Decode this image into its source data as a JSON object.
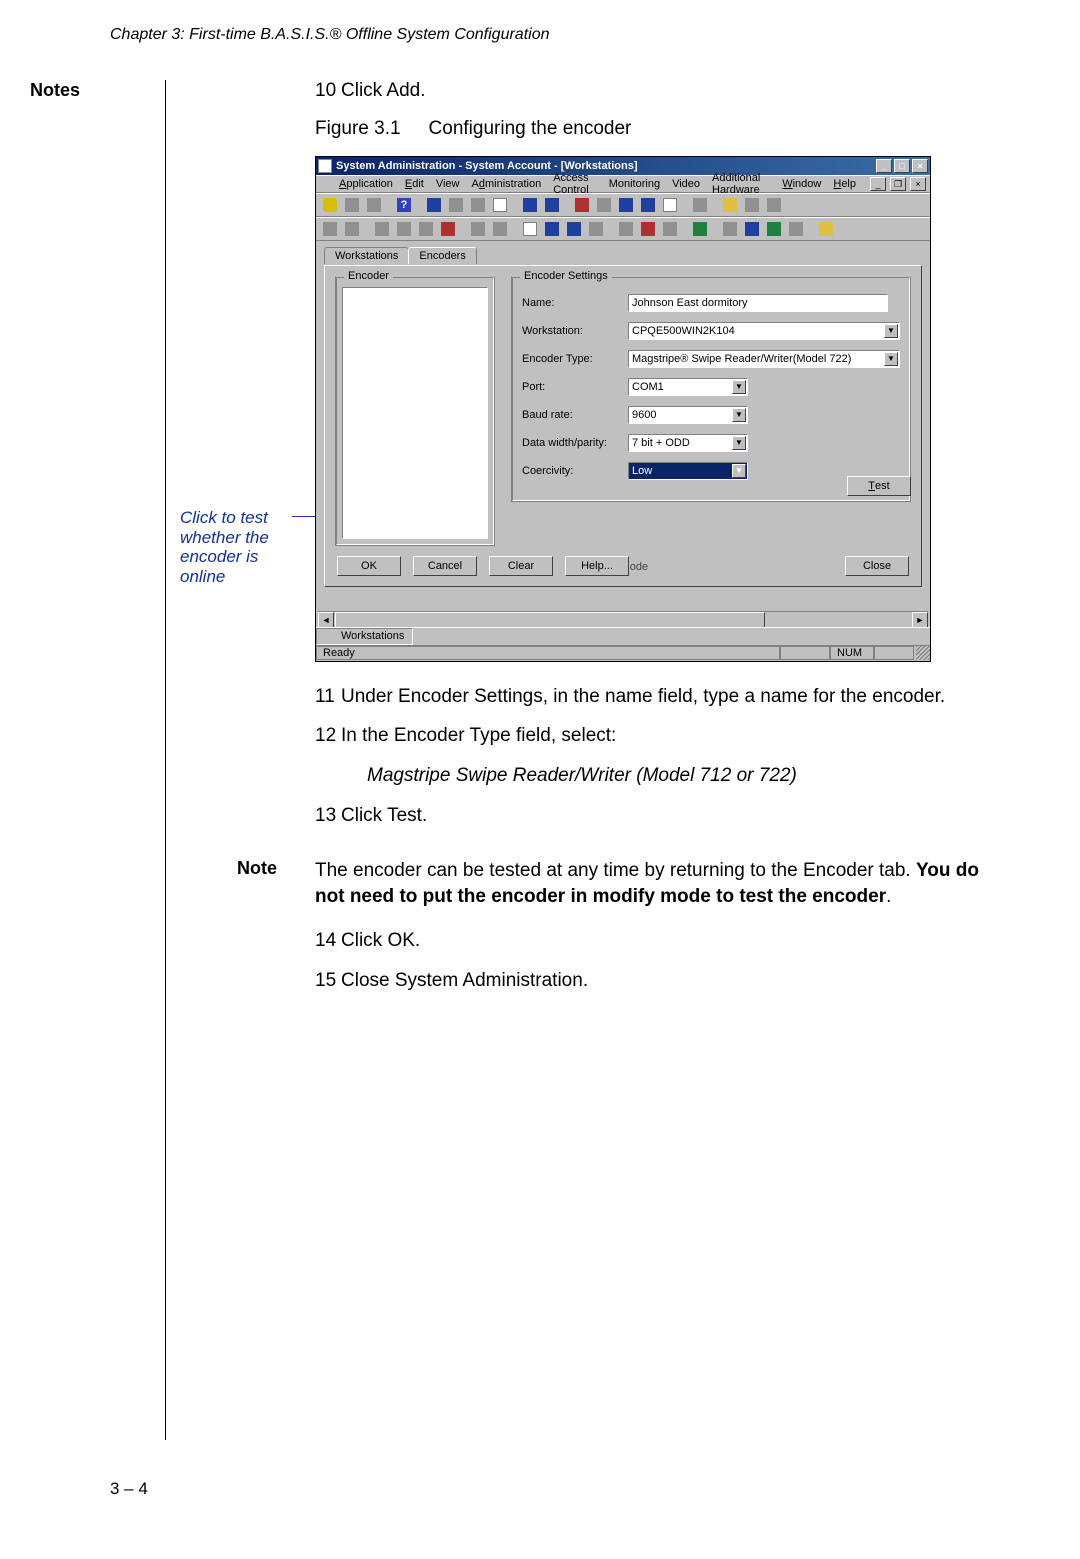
{
  "chapter_header": "Chapter 3: First-time B.A.S.I.S.® Offline System Configuration",
  "notes_label": "Notes",
  "callout_text": "Click to test whether the encoder is online",
  "page_number": "3 – 4",
  "figure": {
    "number": "Figure 3.1",
    "caption": "Configuring the encoder"
  },
  "steps": {
    "s10": {
      "num": "10",
      "text": "Click Add."
    },
    "s11": {
      "num": "11",
      "text": "Under Encoder Settings, in the name field, type a name for the encoder."
    },
    "s12": {
      "num": "12",
      "text": "In the Encoder Type field, select:"
    },
    "s12_sub": "Magstripe Swipe Reader/Writer (Model 712 or 722)",
    "s13": {
      "num": "13",
      "text": "Click Test."
    },
    "s14": {
      "num": "14",
      "text": "Click OK."
    },
    "s15": {
      "num": "15",
      "text": "Close System Administration."
    }
  },
  "note": {
    "label": "Note",
    "pre": "The encoder can be tested at any time by returning to the Encoder tab. ",
    "bold": "You do not need to put the encoder in modify mode to test the encoder",
    "post": "."
  },
  "win": {
    "title": "System Administration - System Account - [Workstations]",
    "winbtn_min": "_",
    "winbtn_max": "□",
    "winbtn_close": "×",
    "menu": {
      "application": "Application",
      "edit": "Edit",
      "view": "View",
      "administration": "Administration",
      "access": "Access Control",
      "monitoring": "Monitoring",
      "video": "Video",
      "addhw": "Additional Hardware",
      "window": "Window",
      "help": "Help"
    },
    "tabs": {
      "workstations": "Workstations",
      "encoders": "Encoders"
    },
    "groups": {
      "encoder": "Encoder",
      "settings": "Encoder Settings"
    },
    "labels": {
      "name": "Name:",
      "workstation": "Workstation:",
      "enctype": "Encoder Type:",
      "port": "Port:",
      "baud": "Baud rate:",
      "parity": "Data width/parity:",
      "coerc": "Coercivity:"
    },
    "values": {
      "name": "Johnson East dormitory",
      "workstation": "CPQE500WIN2K104",
      "enctype": "Magstripe® Swipe Reader/Writer(Model 722)",
      "port": "COM1",
      "baud": "9600",
      "parity": "7 bit + ODD",
      "coerc": "Low"
    },
    "buttons": {
      "test": "Test",
      "ok": "OK",
      "cancel": "Cancel",
      "clear": "Clear",
      "help": "Help...",
      "close": "Close"
    },
    "mode": "Add Mode",
    "taskbar_item": "Workstations",
    "status_ready": "Ready",
    "status_num": "NUM"
  }
}
